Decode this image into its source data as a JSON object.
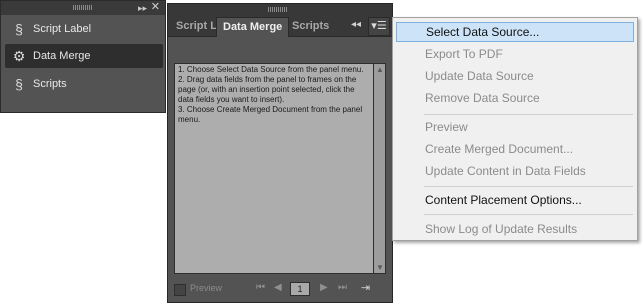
{
  "dock": {
    "items": [
      {
        "label": "Script Label",
        "icon": "script-label-icon"
      },
      {
        "label": "Data Merge",
        "icon": "data-merge-icon"
      },
      {
        "label": "Scripts",
        "icon": "scripts-icon"
      }
    ],
    "collapse_glyph": "▸▸",
    "close_glyph": "✕"
  },
  "panel": {
    "tabs": [
      "Script L",
      "Data Merge",
      "Scripts"
    ],
    "collapse_glyph": "◂◂",
    "menu_glyph": "▾☰",
    "instructions": [
      "1. Choose Select Data Source from the panel menu.",
      "2. Drag data fields from the panel to frames on the page (or, with an insertion point selected, click the data fields you want to insert).",
      "3. Choose Create Merged Document from the panel menu."
    ],
    "footer": {
      "preview_label": "Preview",
      "page_value": "1",
      "first_glyph": "⏮",
      "prev_glyph": "◀",
      "next_glyph": "▶",
      "last_glyph": "⏭",
      "create_glyph": "⇥"
    }
  },
  "menu": {
    "items": [
      {
        "label": "Select Data Source...",
        "enabled": true,
        "selected": true
      },
      {
        "label": "Export To PDF",
        "enabled": false
      },
      {
        "label": "Update Data Source",
        "enabled": false
      },
      {
        "label": "Remove Data Source",
        "enabled": false
      },
      {
        "label": "Preview",
        "enabled": false
      },
      {
        "label": "Create Merged Document...",
        "enabled": false
      },
      {
        "label": "Update Content in Data Fields",
        "enabled": false
      },
      {
        "label": "Content Placement Options...",
        "enabled": true
      },
      {
        "label": "Show Log of Update Results",
        "enabled": false
      }
    ]
  }
}
